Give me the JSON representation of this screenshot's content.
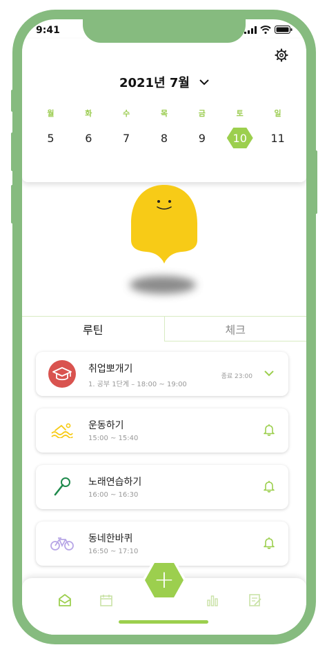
{
  "status_bar": {
    "time": "9:41"
  },
  "calendar": {
    "month_label": "2021년 7월",
    "weekdays": [
      "월",
      "화",
      "수",
      "목",
      "금",
      "토",
      "일"
    ],
    "dates": [
      "5",
      "6",
      "7",
      "8",
      "9",
      "10",
      "11"
    ],
    "selected_date": "10"
  },
  "tabs": [
    {
      "label": "루틴",
      "active": true
    },
    {
      "label": "체크",
      "active": false
    }
  ],
  "routines": [
    {
      "title": "취업뽀개기",
      "subtitle": "1. 공부 1단계 – 18:00 ~ 19:00",
      "end_label": "종료 23:00",
      "icon": "graduation-cap-icon",
      "action": "chevron-down-icon"
    },
    {
      "title": "운동하기",
      "subtitle": "15:00 ~ 15:40",
      "icon": "swimming-icon",
      "action": "bell-icon"
    },
    {
      "title": "노래연습하기",
      "subtitle": "16:00 ~ 16:30",
      "icon": "microphone-icon",
      "action": "bell-icon"
    },
    {
      "title": "동네한바퀴",
      "subtitle": "16:50 ~ 17:10",
      "icon": "bicycle-icon",
      "action": "bell-icon"
    }
  ],
  "bottom_nav": [
    "home-icon",
    "calendar-icon",
    "add-icon",
    "chart-icon",
    "note-icon"
  ],
  "colors": {
    "accent": "#9ccf4e",
    "frame": "#86bb7f",
    "mascot": "#f7cb17",
    "badge_red": "#d9534f"
  }
}
